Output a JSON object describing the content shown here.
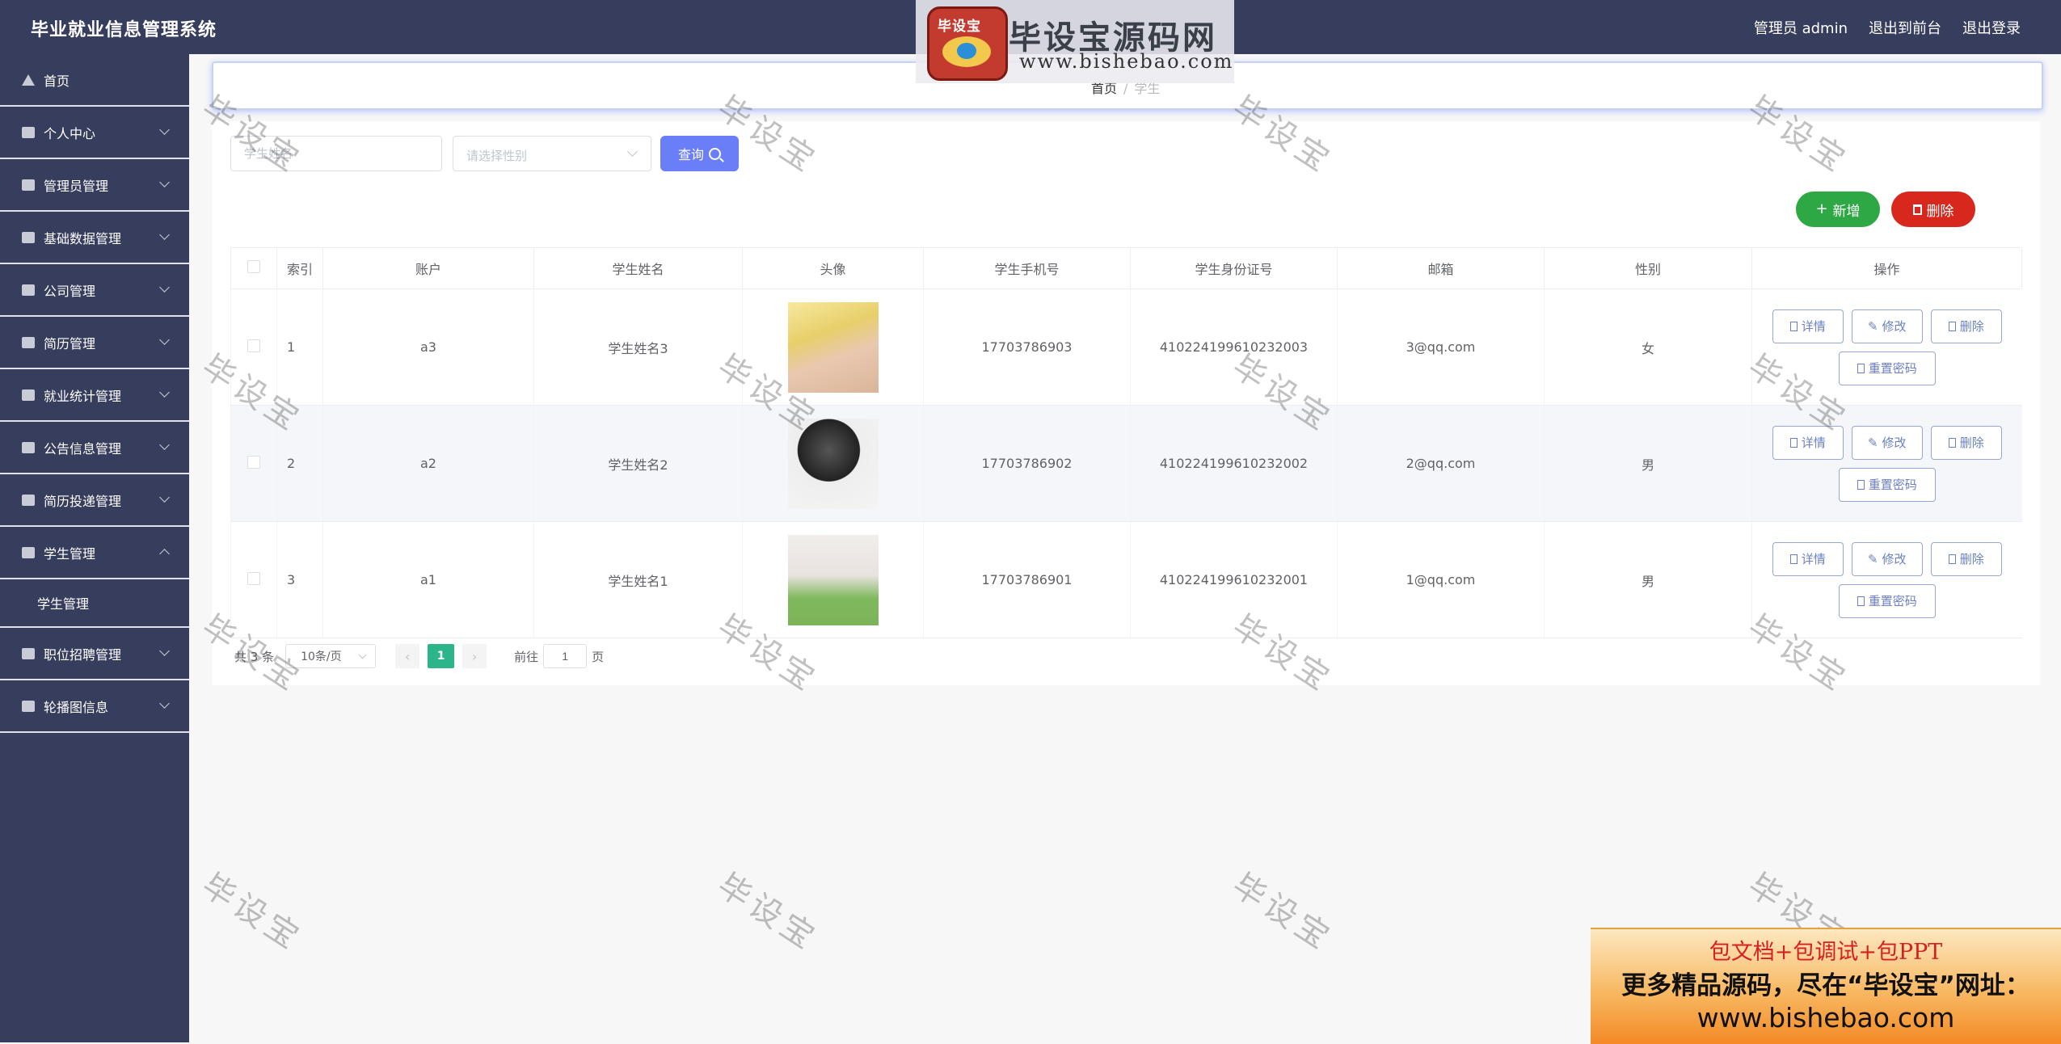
{
  "header": {
    "app_title": "毕业就业信息管理系统",
    "user": "管理员 admin",
    "to_front": "退出到前台",
    "logout": "退出登录"
  },
  "logo_watermark": {
    "badge": "毕设宝",
    "main": "毕设宝源码网",
    "url": "www.bishebao.com"
  },
  "sidebar": {
    "items": [
      {
        "label": "首页",
        "icon": "home-icon",
        "arrow": "none"
      },
      {
        "label": "个人中心",
        "icon": "user-icon",
        "arrow": "down"
      },
      {
        "label": "管理员管理",
        "icon": "admin-icon",
        "arrow": "down"
      },
      {
        "label": "基础数据管理",
        "icon": "bell-off-icon",
        "arrow": "down"
      },
      {
        "label": "公司管理",
        "icon": "monitor-icon",
        "arrow": "down"
      },
      {
        "label": "简历管理",
        "icon": "briefcase-icon",
        "arrow": "down"
      },
      {
        "label": "就业统计管理",
        "icon": "chart-icon",
        "arrow": "down"
      },
      {
        "label": "公告信息管理",
        "icon": "globe-icon",
        "arrow": "down"
      },
      {
        "label": "简历投递管理",
        "icon": "gauge-icon",
        "arrow": "down"
      },
      {
        "label": "学生管理",
        "icon": "menu-icon",
        "arrow": "up"
      },
      {
        "label": "职位招聘管理",
        "icon": "bulb-icon",
        "arrow": "down"
      },
      {
        "label": "轮播图信息",
        "icon": "ticket-icon",
        "arrow": "down"
      }
    ],
    "submenu": {
      "label": "学生管理"
    }
  },
  "breadcrumb": {
    "home": "首页",
    "sep": "/",
    "current": "学生"
  },
  "search": {
    "name_placeholder": "学生姓名",
    "gender_placeholder": "请选择性别",
    "query_label": "查询"
  },
  "actions": {
    "add_label": "新增",
    "delete_label": "删除"
  },
  "table": {
    "headers": [
      "",
      "索引",
      "账户",
      "学生姓名",
      "头像",
      "学生手机号",
      "学生身份证号",
      "邮箱",
      "性别",
      "操作"
    ],
    "rows": [
      {
        "index": "1",
        "account": "a3",
        "name": "学生姓名3",
        "phone": "17703786903",
        "id_card": "410224199610232003",
        "email": "3@qq.com",
        "gender": "女"
      },
      {
        "index": "2",
        "account": "a2",
        "name": "学生姓名2",
        "phone": "17703786902",
        "id_card": "410224199610232002",
        "email": "2@qq.com",
        "gender": "男"
      },
      {
        "index": "3",
        "account": "a1",
        "name": "学生姓名1",
        "phone": "17703786901",
        "id_card": "410224199610232001",
        "email": "1@qq.com",
        "gender": "男"
      }
    ],
    "op_labels": {
      "detail": "详情",
      "edit": "修改",
      "delete": "删除",
      "reset": "重置密码"
    }
  },
  "pagination": {
    "total": "共 3 条",
    "page_size": "10条/页",
    "current": "1",
    "goto_prefix": "前往",
    "goto_value": "1",
    "goto_suffix": "页"
  },
  "watermark_text": "毕设宝",
  "promo": {
    "line1": "包文档+包调试+包PPT",
    "line2": "更多精品源码，尽在“毕设宝”网址：",
    "line3": "www.bishebao.com"
  },
  "colors": {
    "sidebar_bg": "#373d5c",
    "query_button": "#6a7ff7",
    "add_button": "#2ea745",
    "delete_button": "#d8281d",
    "page_active": "#2bb589"
  }
}
